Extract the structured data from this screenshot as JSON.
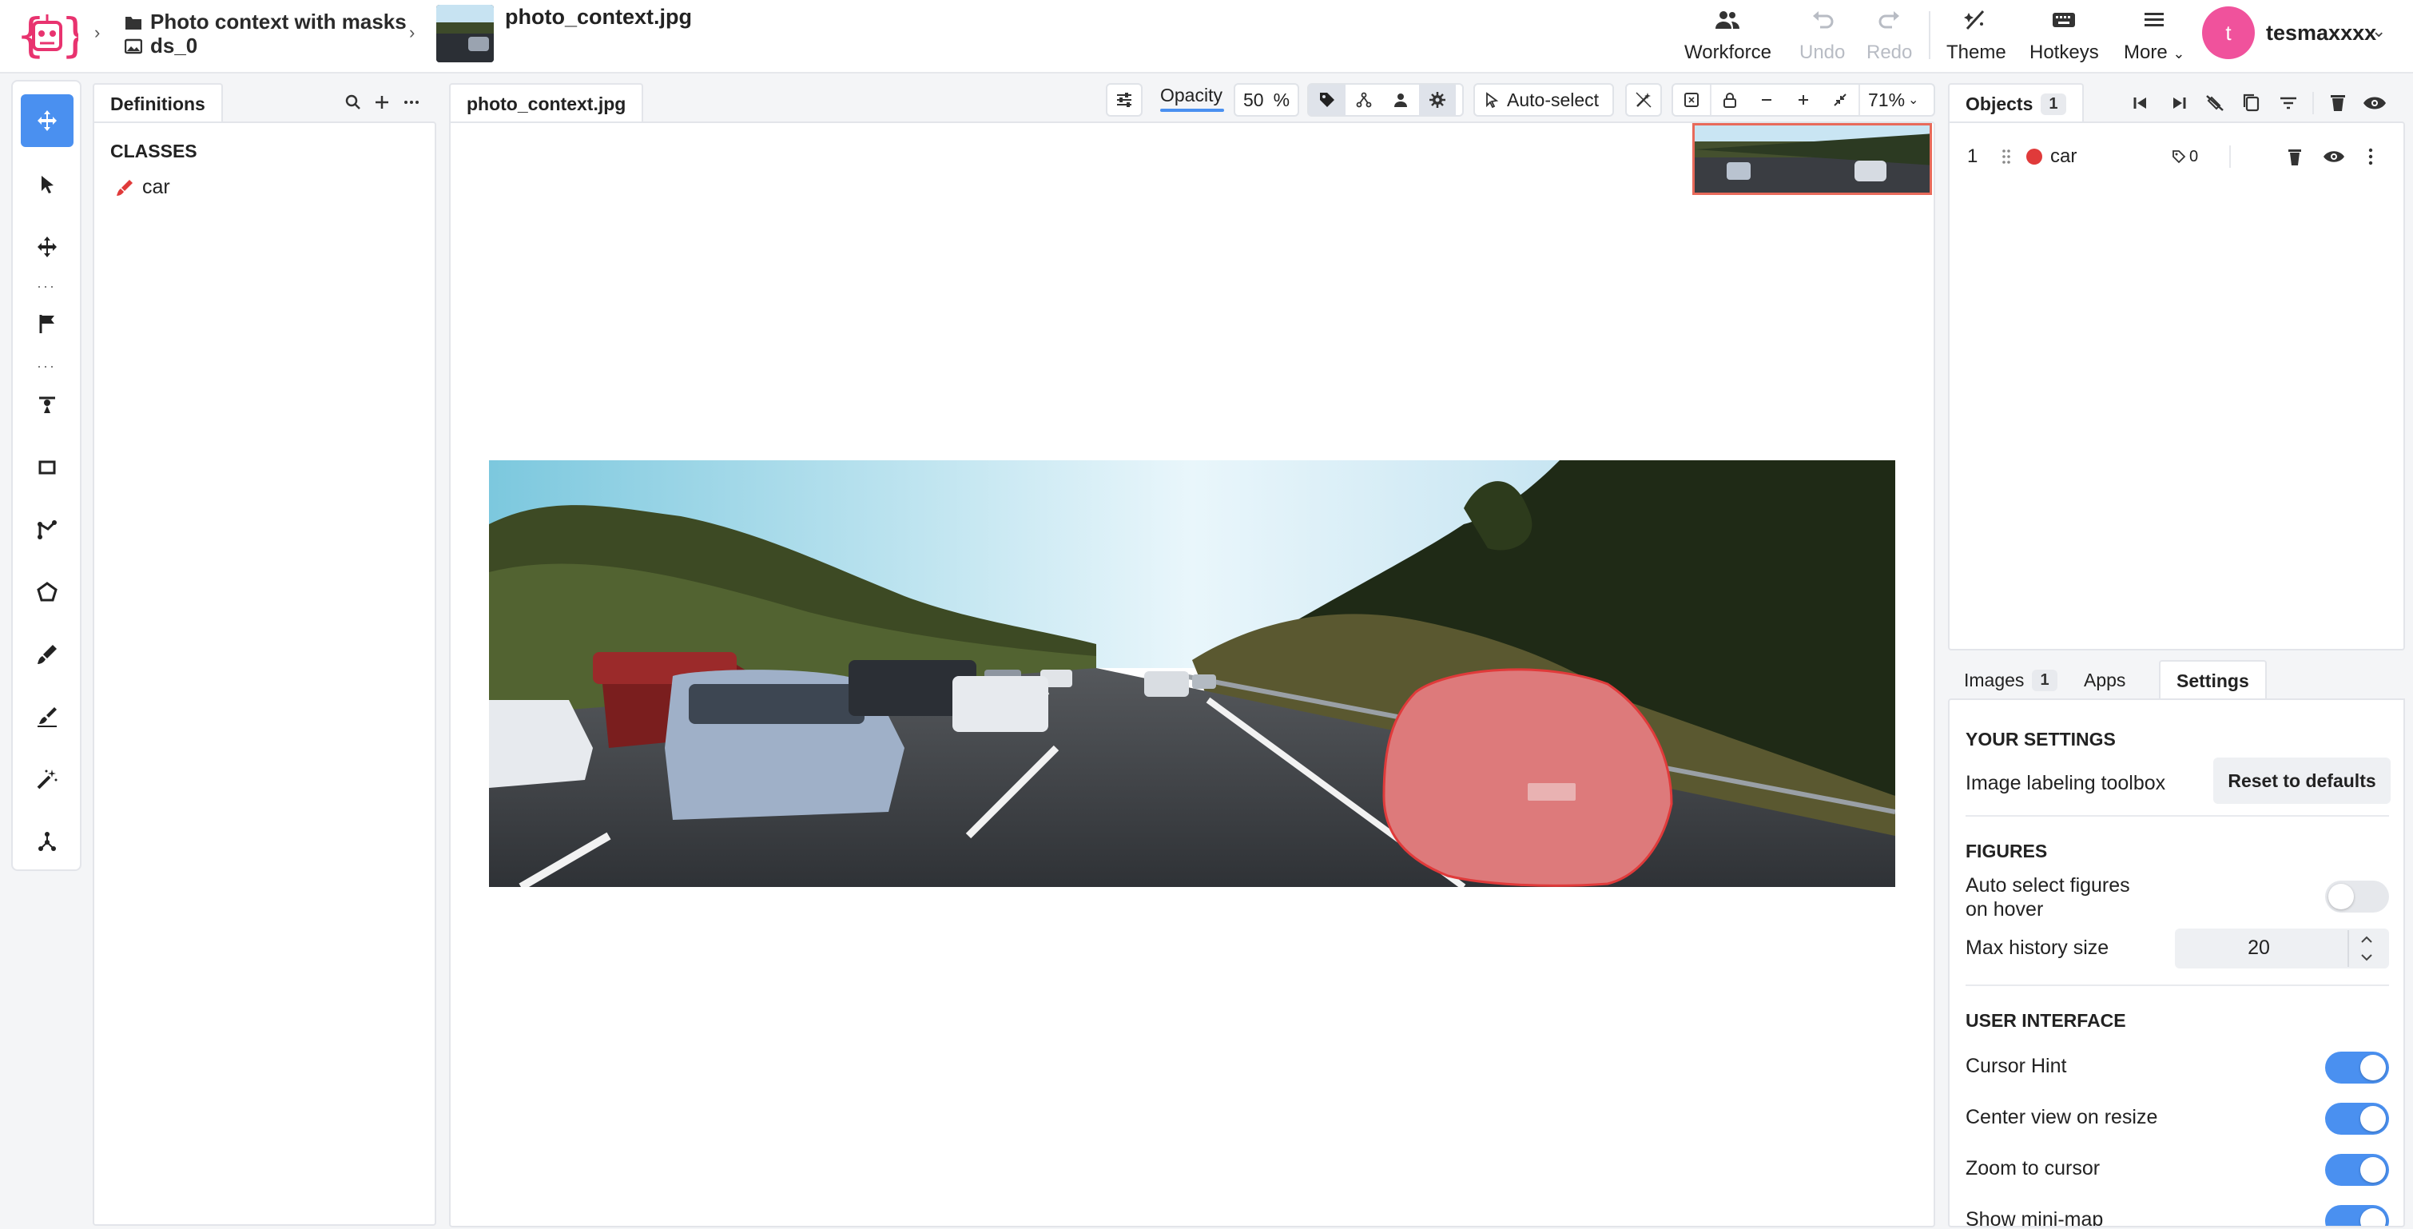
{
  "breadcrumb": {
    "project": "Photo context with masks",
    "dataset": "ds_0",
    "file": "photo_context.jpg"
  },
  "topnav": {
    "workforce": "Workforce",
    "undo": "Undo",
    "redo": "Redo",
    "theme": "Theme",
    "hotkeys": "Hotkeys",
    "more": "More",
    "avatar_letter": "t",
    "username": "tesmaxxxx"
  },
  "definitions": {
    "tab_label": "Definitions",
    "classes_heading": "CLASSES",
    "classes": [
      {
        "name": "car",
        "color": "#e03a3a"
      }
    ]
  },
  "canvas": {
    "tab_label": "photo_context.jpg",
    "opacity_label": "Opacity",
    "opacity_value": "50",
    "opacity_unit": "%",
    "auto_select": "Auto-select",
    "zoom": "71%"
  },
  "objects": {
    "tab_label": "Objects",
    "count": "1",
    "items": [
      {
        "index": "1",
        "name": "car",
        "color": "#e03a3a",
        "tags": "0"
      }
    ]
  },
  "lower_tabs": {
    "images": "Images",
    "images_count": "1",
    "apps": "Apps",
    "settings": "Settings"
  },
  "settings": {
    "your_settings": "YOUR SETTINGS",
    "toolbox_label": "Image labeling toolbox",
    "reset_button": "Reset to defaults",
    "figures_heading": "FIGURES",
    "auto_select_label_1": "Auto select figures",
    "auto_select_label_2": "on hover",
    "auto_select_on": false,
    "max_history_label": "Max history size",
    "max_history_value": "20",
    "ui_heading": "USER INTERFACE",
    "cursor_hint": "Cursor Hint",
    "center_view": "Center view on resize",
    "zoom_to_cursor": "Zoom to cursor",
    "show_minimap": "Show mini-map"
  },
  "colors": {
    "accent": "#4a90f0",
    "class_red": "#e03a3a",
    "logo_pink": "#e8336f"
  }
}
